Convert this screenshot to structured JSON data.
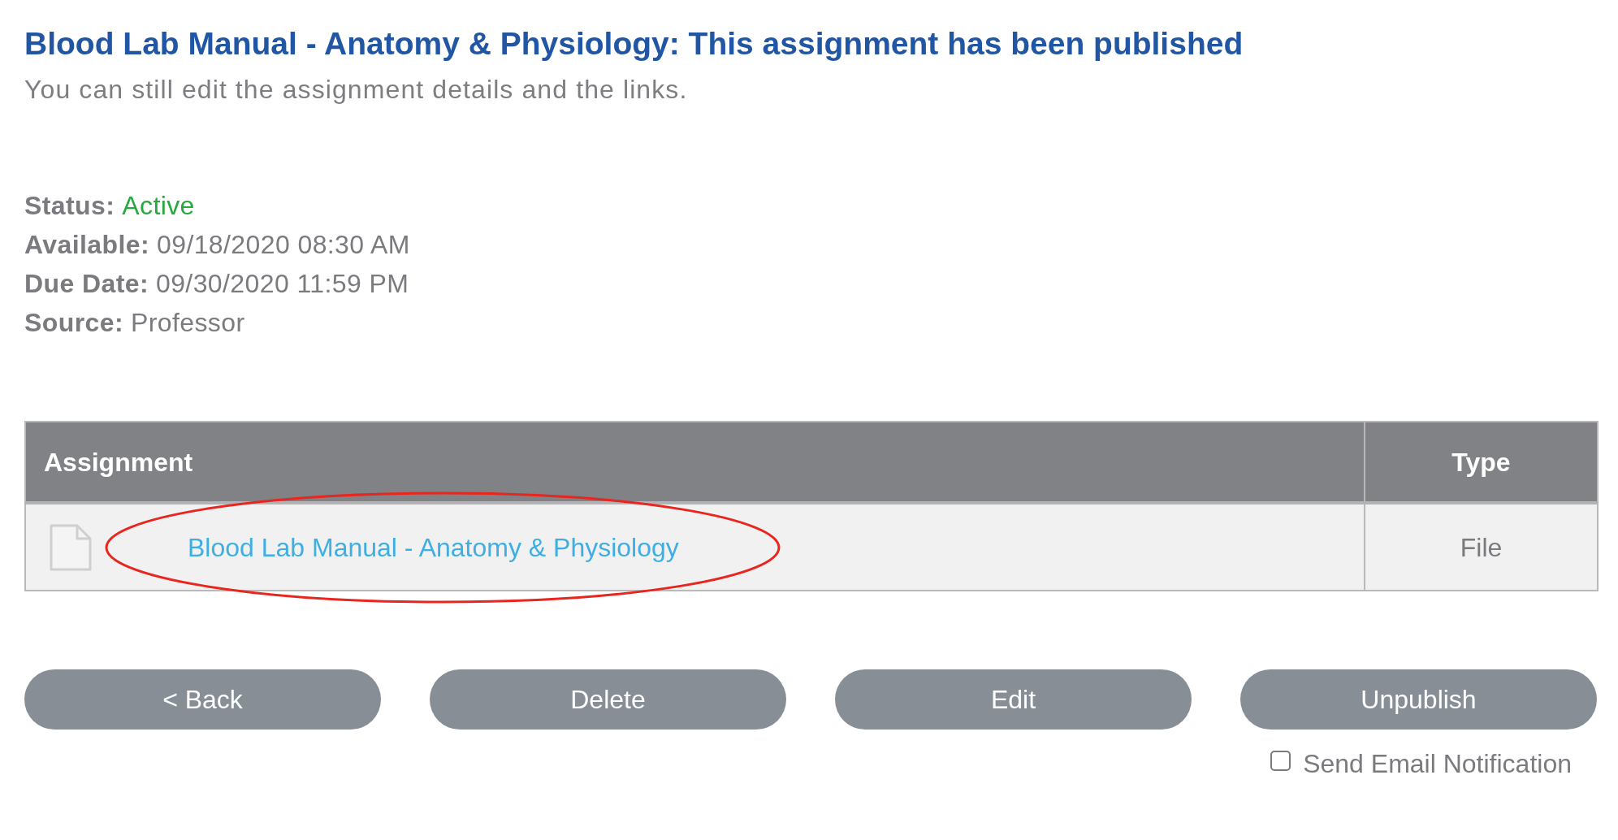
{
  "header": {
    "title": "Blood Lab Manual - Anatomy & Physiology: This assignment has been published",
    "subtitle": "You can still edit the assignment details and the links."
  },
  "details": [
    {
      "label": "Status:",
      "value": "Active",
      "kind": "status"
    },
    {
      "label": "Available:",
      "value": "09/18/2020 08:30 AM",
      "kind": "text"
    },
    {
      "label": "Due Date:",
      "value": "09/30/2020 11:59 PM",
      "kind": "text"
    },
    {
      "label": "Source:",
      "value": "Professor",
      "kind": "text"
    }
  ],
  "table": {
    "columns": [
      "Assignment",
      "Type"
    ],
    "rows": [
      {
        "assignment": "Blood Lab Manual - Anatomy & Physiology",
        "type": "File"
      }
    ]
  },
  "buttons": [
    "< Back",
    "Delete",
    "Edit",
    "Unpublish"
  ],
  "email_notification": {
    "label": "Send Email Notification",
    "checked": false
  }
}
